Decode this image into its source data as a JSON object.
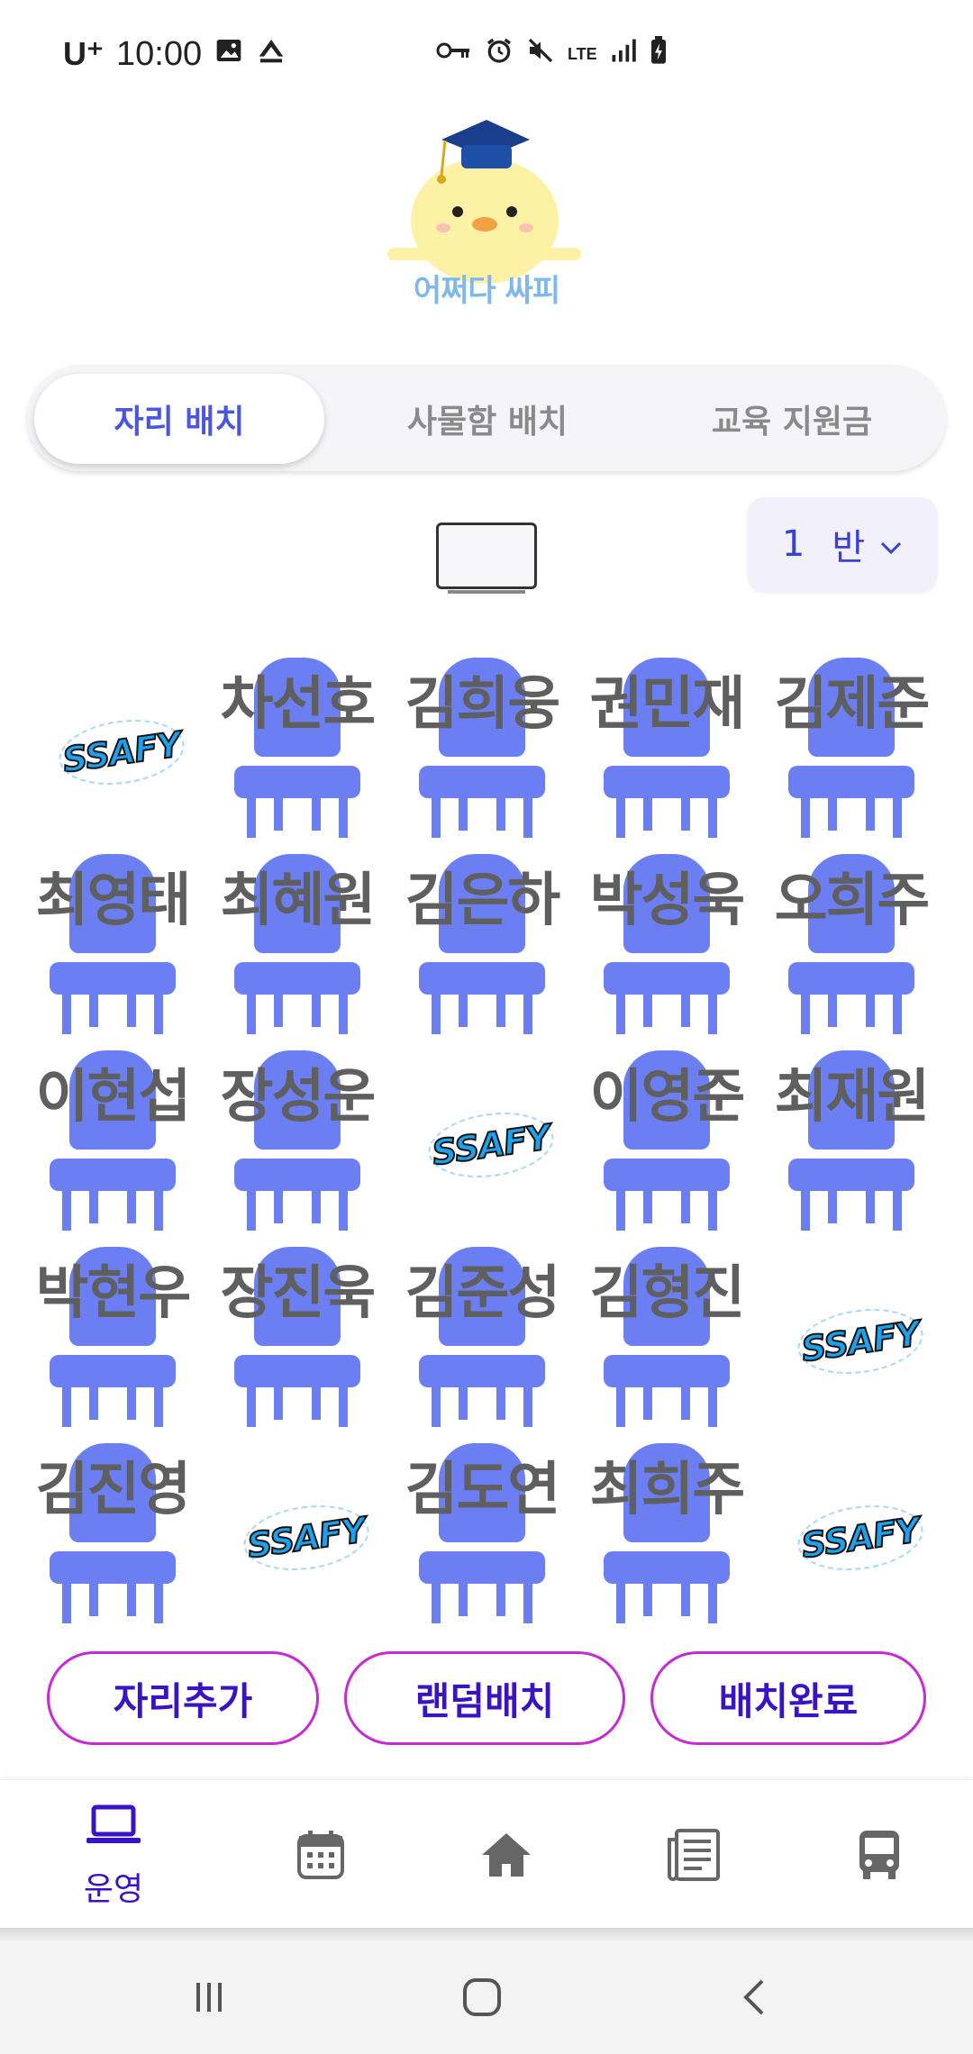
{
  "status_bar": {
    "carrier": "U⁺",
    "time": "10:00",
    "left_icons": [
      "image-icon",
      "upload-icon"
    ],
    "right_icons": [
      "vpn-key-icon",
      "alarm-icon",
      "mute-icon",
      "lte-icon",
      "signal-icon",
      "battery-charging-icon"
    ],
    "network": "LTE"
  },
  "logo": {
    "text": "어쩌다 싸피"
  },
  "segment_tabs": [
    {
      "label": "자리 배치",
      "active": true
    },
    {
      "label": "사물함 배치",
      "active": false
    },
    {
      "label": "교육 지원금",
      "active": false
    }
  ],
  "class_selector": {
    "value": "1",
    "unit": "반"
  },
  "seating": {
    "rows": [
      [
        {
          "type": "ssafy"
        },
        {
          "type": "seat",
          "name": "차선호"
        },
        {
          "type": "seat",
          "name": "김희웅"
        },
        {
          "type": "seat",
          "name": "권민재"
        },
        {
          "type": "seat",
          "name": "김제준"
        }
      ],
      [
        {
          "type": "seat",
          "name": "최영태"
        },
        {
          "type": "seat",
          "name": "최혜원"
        },
        {
          "type": "seat",
          "name": "김은하"
        },
        {
          "type": "seat",
          "name": "박성욱"
        },
        {
          "type": "seat",
          "name": "오희주"
        }
      ],
      [
        {
          "type": "seat",
          "name": "이현섭"
        },
        {
          "type": "seat",
          "name": "장성운"
        },
        {
          "type": "ssafy"
        },
        {
          "type": "seat",
          "name": "이영준"
        },
        {
          "type": "seat",
          "name": "최재원"
        }
      ],
      [
        {
          "type": "seat",
          "name": "박현우"
        },
        {
          "type": "seat",
          "name": "장진욱"
        },
        {
          "type": "seat",
          "name": "김준성"
        },
        {
          "type": "seat",
          "name": "김형진"
        },
        {
          "type": "ssafy"
        }
      ],
      [
        {
          "type": "seat",
          "name": "김진영"
        },
        {
          "type": "ssafy"
        },
        {
          "type": "seat",
          "name": "김도연"
        },
        {
          "type": "seat",
          "name": "최희주"
        },
        {
          "type": "ssafy"
        }
      ]
    ],
    "ssafy_label": "SSAFY"
  },
  "actions": {
    "add_seat": "자리추가",
    "random": "랜덤배치",
    "done": "배치완료"
  },
  "bottom_nav": [
    {
      "icon": "laptop-icon",
      "label": "운영",
      "active": true
    },
    {
      "icon": "calendar-icon",
      "label": "",
      "active": false
    },
    {
      "icon": "home-icon",
      "label": "",
      "active": false
    },
    {
      "icon": "newspaper-icon",
      "label": "",
      "active": false
    },
    {
      "icon": "bus-icon",
      "label": "",
      "active": false
    }
  ],
  "colors": {
    "primary": "#4a56e2",
    "chair": "#6b7ff3",
    "button_border": "#c72ad2",
    "button_text": "#3a13c4"
  }
}
